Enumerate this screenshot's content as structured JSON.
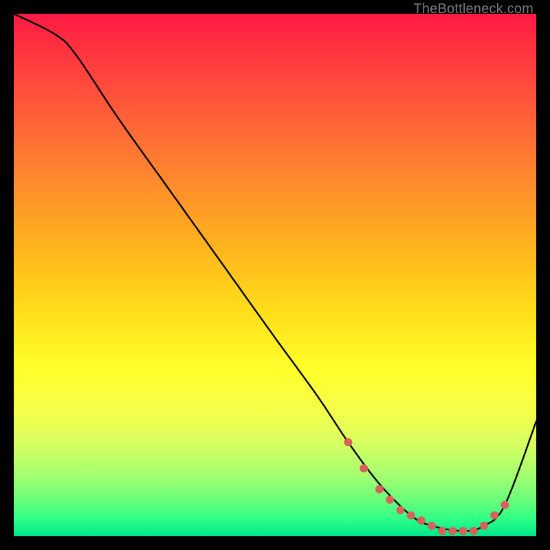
{
  "watermark": "TheBottleneck.com",
  "chart_data": {
    "type": "line",
    "title": "",
    "xlabel": "",
    "ylabel": "",
    "xlim": [
      0,
      100
    ],
    "ylim": [
      0,
      100
    ],
    "series": [
      {
        "name": "curve",
        "x": [
          0,
          8,
          12,
          20,
          30,
          40,
          50,
          58,
          64,
          70,
          76,
          80,
          86,
          90,
          94,
          100
        ],
        "values": [
          100,
          96,
          92,
          80,
          66,
          52,
          38,
          27,
          18,
          10,
          4,
          2,
          1,
          2,
          6,
          22
        ]
      }
    ],
    "markers": {
      "name": "highlight-dots",
      "color": "#d8615a",
      "x": [
        64,
        67,
        70,
        72,
        74,
        76,
        78,
        80,
        82,
        84,
        86,
        88,
        90,
        92,
        94
      ],
      "values": [
        18,
        13,
        9,
        7,
        5,
        4,
        3,
        2,
        1,
        1,
        1,
        1,
        2,
        4,
        6
      ]
    }
  }
}
